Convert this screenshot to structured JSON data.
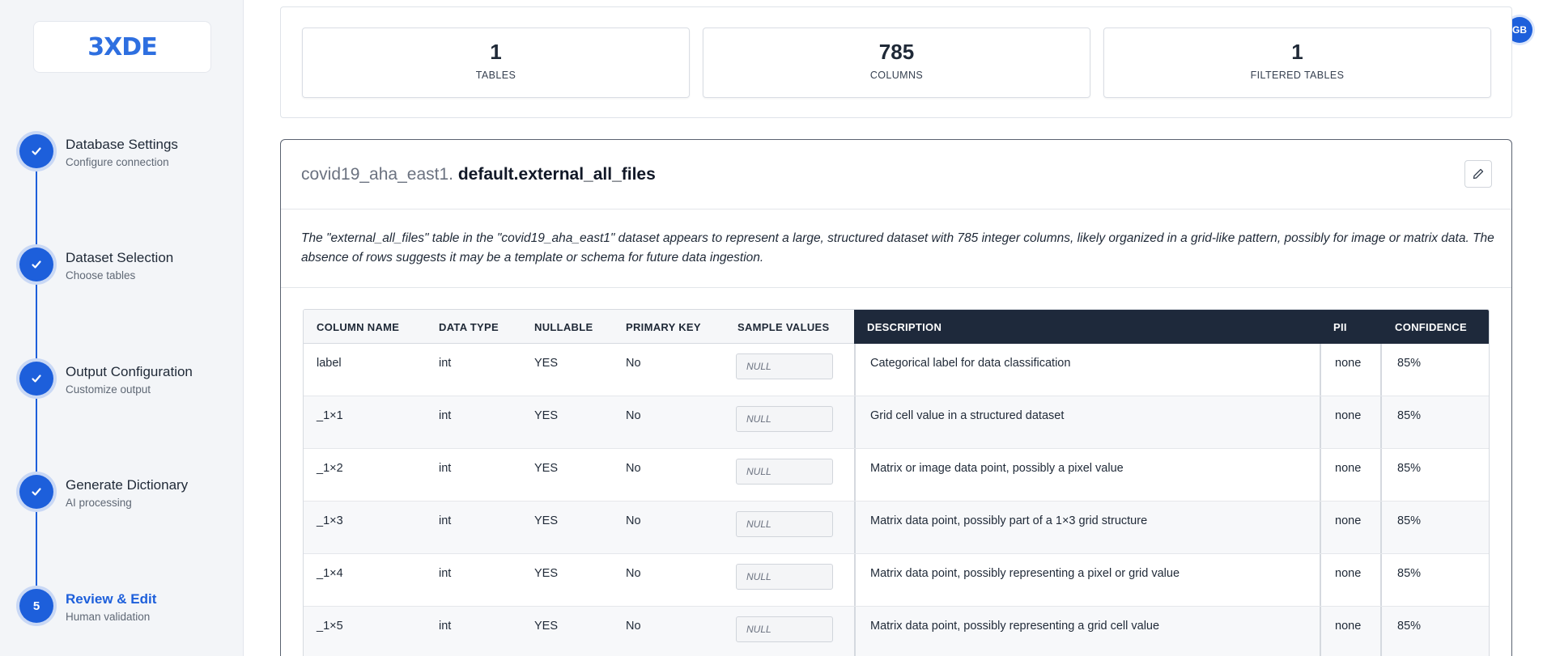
{
  "app": {
    "logo": "3XDE",
    "user_initials": "GB"
  },
  "steps": [
    {
      "title": "Database Settings",
      "subtitle": "Configure connection",
      "state": "done",
      "icon": "check-icon"
    },
    {
      "title": "Dataset Selection",
      "subtitle": "Choose tables",
      "state": "done",
      "icon": "check-icon"
    },
    {
      "title": "Output Configuration",
      "subtitle": "Customize output",
      "state": "done",
      "icon": "check-icon"
    },
    {
      "title": "Generate Dictionary",
      "subtitle": "AI processing",
      "state": "done",
      "icon": "check-icon"
    },
    {
      "title": "Review & Edit",
      "subtitle": "Human validation",
      "state": "active",
      "number": "5"
    }
  ],
  "stats": [
    {
      "value": "1",
      "label": "TABLES"
    },
    {
      "value": "785",
      "label": "COLUMNS"
    },
    {
      "value": "1",
      "label": "FILTERED TABLES"
    }
  ],
  "table_panel": {
    "dataset_prefix": "covid19_aha_east1.",
    "table_name": "default.external_all_files",
    "edit_icon": "pencil-icon",
    "description": "The \"external_all_files\" table in the \"covid19_aha_east1\" dataset appears to represent a large, structured dataset with 785 integer columns, likely organized in a grid-like pattern, possibly for image or matrix data. The absence of rows suggests it may be a template or schema for future data ingestion."
  },
  "grid": {
    "headers": {
      "column_name": "COLUMN NAME",
      "data_type": "DATA TYPE",
      "nullable": "NULLABLE",
      "primary_key": "PRIMARY KEY",
      "sample_values": "SAMPLE VALUES",
      "description": "DESCRIPTION",
      "pii": "PII",
      "confidence": "CONFIDENCE"
    },
    "rows": [
      {
        "name": "label",
        "type": "int",
        "nullable": "YES",
        "pk": "No",
        "sample": "NULL",
        "description": "Categorical label for data classification",
        "pii": "none",
        "confidence": "85%"
      },
      {
        "name": "_1×1",
        "type": "int",
        "nullable": "YES",
        "pk": "No",
        "sample": "NULL",
        "description": "Grid cell value in a structured dataset",
        "pii": "none",
        "confidence": "85%"
      },
      {
        "name": "_1×2",
        "type": "int",
        "nullable": "YES",
        "pk": "No",
        "sample": "NULL",
        "description": "Matrix or image data point, possibly a pixel value",
        "pii": "none",
        "confidence": "85%"
      },
      {
        "name": "_1×3",
        "type": "int",
        "nullable": "YES",
        "pk": "No",
        "sample": "NULL",
        "description": "Matrix data point, possibly part of a 1×3 grid structure",
        "pii": "none",
        "confidence": "85%"
      },
      {
        "name": "_1×4",
        "type": "int",
        "nullable": "YES",
        "pk": "No",
        "sample": "NULL",
        "description": "Matrix data point, possibly representing a pixel or grid value",
        "pii": "none",
        "confidence": "85%"
      },
      {
        "name": "_1×5",
        "type": "int",
        "nullable": "YES",
        "pk": "No",
        "sample": "NULL",
        "description": "Matrix data point, possibly representing a grid cell value",
        "pii": "none",
        "confidence": "85%"
      }
    ]
  },
  "colors": {
    "accent": "#1d5fdb",
    "header_dark": "#1e293b",
    "sidebar_bg": "#f3f5f8"
  }
}
